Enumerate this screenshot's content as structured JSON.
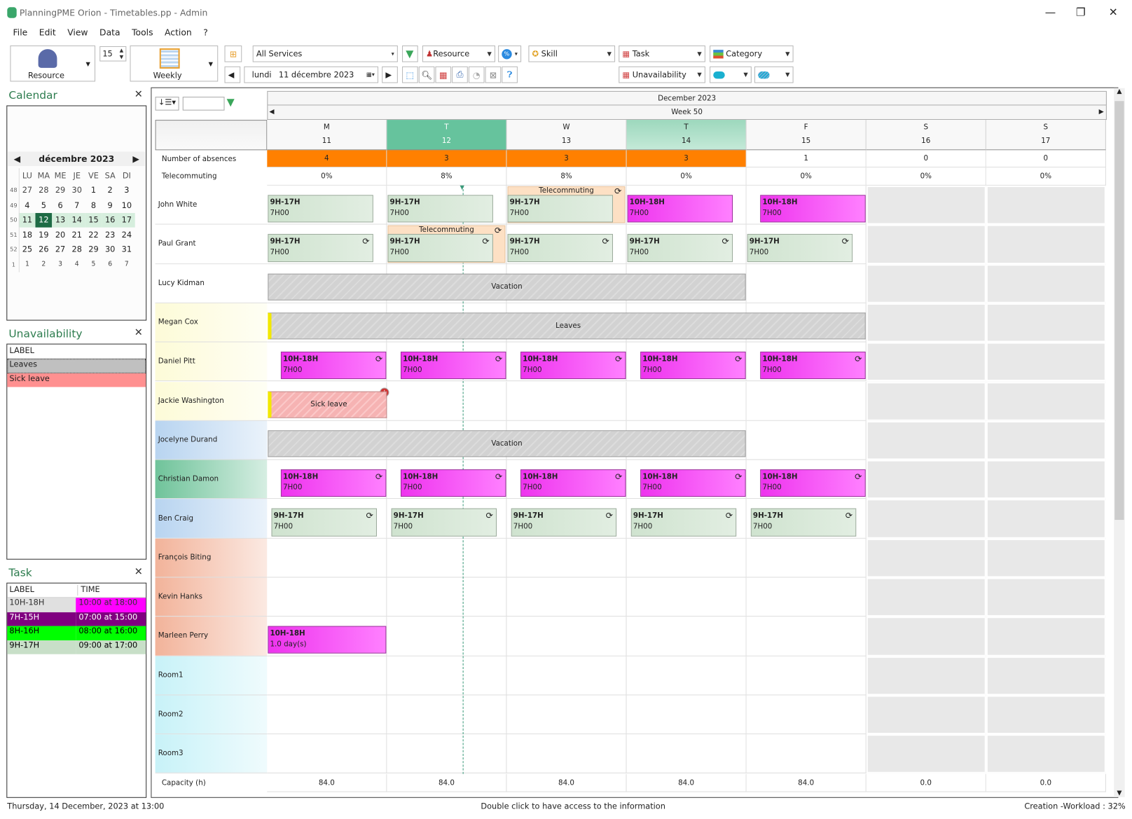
{
  "window": {
    "title": "PlanningPME Orion - Timetables.pp - Admin",
    "minimize": "—",
    "restore": "❐",
    "close": "✕"
  },
  "menu": [
    "File",
    "Edit",
    "View",
    "Data",
    "Tools",
    "Action",
    "?"
  ],
  "toolbar": {
    "view_mode": "Resource",
    "spinner_value": "15",
    "period": "Weekly",
    "services": "All Services",
    "resource_filter": "Resource",
    "skill": "Skill",
    "task": "Task",
    "category": "Category",
    "unavailability": "Unavailability",
    "date_day": "lundi",
    "date": "11 décembre 2023"
  },
  "calendar_panel": {
    "title": "Calendar",
    "month": "décembre 2023",
    "weekdays": [
      "LU",
      "MA",
      "ME",
      "JE",
      "VE",
      "SA",
      "DI"
    ],
    "weeks": [
      {
        "num": "48",
        "days": [
          "27",
          "28",
          "29",
          "30",
          "1",
          "2",
          "3"
        ]
      },
      {
        "num": "49",
        "days": [
          "4",
          "5",
          "6",
          "7",
          "8",
          "9",
          "10"
        ]
      },
      {
        "num": "50",
        "days": [
          "11",
          "12",
          "13",
          "14",
          "15",
          "16",
          "17"
        ],
        "current": true
      },
      {
        "num": "51",
        "days": [
          "18",
          "19",
          "20",
          "21",
          "22",
          "23",
          "24"
        ]
      },
      {
        "num": "52",
        "days": [
          "25",
          "26",
          "27",
          "28",
          "29",
          "30",
          "31"
        ]
      },
      {
        "num": "1",
        "days": [
          "1",
          "2",
          "3",
          "4",
          "5",
          "6",
          "7"
        ]
      }
    ],
    "selected_day": "12"
  },
  "unavailability_panel": {
    "title": "Unavailability",
    "header": "LABEL",
    "items": [
      {
        "label": "Leaves",
        "color": "#c0c0c0"
      },
      {
        "label": "Sick leave",
        "color": "#ff9090"
      }
    ]
  },
  "task_panel": {
    "title": "Task",
    "headers": [
      "LABEL",
      "TIME"
    ],
    "items": [
      {
        "label": "10H-18H",
        "time": "10:00 at 18:00",
        "color": "#ff00ff",
        "label_bg": "#e0e0e0",
        "text": "#333"
      },
      {
        "label": "7H-15H",
        "time": "07:00 at 15:00",
        "color": "#800080",
        "label_bg": "#800080",
        "text": "#fff"
      },
      {
        "label": "8H-16H",
        "time": "08:00 at 16:00",
        "color": "#00ff00",
        "label_bg": "#00ff00",
        "text": "#000"
      },
      {
        "label": "9H-17H",
        "time": "09:00 at 17:00",
        "color": "#c8dfc8",
        "label_bg": "#c8dfc8",
        "text": "#000"
      }
    ]
  },
  "planning": {
    "month": "December 2023",
    "week": "Week 50",
    "days": [
      {
        "letter": "M",
        "num": "11"
      },
      {
        "letter": "T",
        "num": "12",
        "today": true
      },
      {
        "letter": "W",
        "num": "13"
      },
      {
        "letter": "T",
        "num": "14",
        "highlight": true
      },
      {
        "letter": "F",
        "num": "15"
      },
      {
        "letter": "S",
        "num": "16",
        "weekend": true
      },
      {
        "letter": "S",
        "num": "17",
        "weekend": true
      }
    ],
    "absences": {
      "label": "Number of absences",
      "values": [
        "4",
        "3",
        "3",
        "3",
        "1",
        "0",
        "0"
      ]
    },
    "telecommuting": {
      "label": "Telecommuting",
      "values": [
        "0%",
        "8%",
        "8%",
        "0%",
        "0%",
        "0%",
        "0%"
      ]
    },
    "capacity": {
      "label": "Capacity (h)",
      "values": [
        "84.0",
        "84.0",
        "84.0",
        "84.0",
        "84.0",
        "0.0",
        "0.0"
      ]
    },
    "resources": [
      {
        "name": "John White",
        "color": "#ffffff"
      },
      {
        "name": "Paul Grant",
        "color": "#ffffff"
      },
      {
        "name": "Lucy Kidman",
        "color": "#ffffff"
      },
      {
        "name": "Megan Cox",
        "color": "#fdfbd8"
      },
      {
        "name": "Daniel Pitt",
        "color": "#fdfbd8"
      },
      {
        "name": "Jackie Washington",
        "color": "#fdfbd8"
      },
      {
        "name": "Jocelyne Durand",
        "color": "#b8d4f0"
      },
      {
        "name": "Christian Damon",
        "color": "#6fc39a"
      },
      {
        "name": "Ben Craig",
        "color": "#b8d4f0"
      },
      {
        "name": "François Biting",
        "color": "#f2b39a"
      },
      {
        "name": "Kevin Hanks",
        "color": "#f2b39a"
      },
      {
        "name": "Marleen Perry",
        "color": "#f2b39a"
      },
      {
        "name": "Room1",
        "color": "#c8f2f8"
      },
      {
        "name": "Room2",
        "color": "#c8f2f8"
      },
      {
        "name": "Room3",
        "color": "#c8f2f8"
      }
    ],
    "telecommuting_label": "Telecommuting",
    "events": [
      {
        "row": 0,
        "day": 0,
        "kind": "green",
        "label": "9H-17H",
        "sub": "7H00"
      },
      {
        "row": 0,
        "day": 1,
        "kind": "green",
        "label": "9H-17H",
        "sub": "7H00"
      },
      {
        "row": 0,
        "day": 2,
        "kind": "green",
        "label": "9H-17H",
        "sub": "7H00",
        "telecommuting": true
      },
      {
        "row": 0,
        "day": 3,
        "kind": "magenta",
        "label": "10H-18H",
        "sub": "7H00"
      },
      {
        "row": 0,
        "day": 4,
        "kind": "magenta",
        "label": "10H-18H",
        "sub": "7H00",
        "late_start": true
      },
      {
        "row": 1,
        "day": 0,
        "kind": "green",
        "label": "9H-17H",
        "sub": "7H00",
        "sync": true
      },
      {
        "row": 1,
        "day": 1,
        "kind": "green",
        "label": "9H-17H",
        "sub": "7H00",
        "sync": true,
        "telecommuting": true
      },
      {
        "row": 1,
        "day": 2,
        "kind": "green",
        "label": "9H-17H",
        "sub": "7H00",
        "sync": true
      },
      {
        "row": 1,
        "day": 3,
        "kind": "green",
        "label": "9H-17H",
        "sub": "7H00",
        "sync": true
      },
      {
        "row": 1,
        "day": 4,
        "kind": "green",
        "label": "9H-17H",
        "sub": "7H00",
        "sync": true
      },
      {
        "row": 2,
        "day": 0,
        "days": 4,
        "kind": "vac",
        "label": "Vacation"
      },
      {
        "row": 3,
        "day": 0,
        "days": 5,
        "kind": "vac leaves",
        "label": "Leaves"
      },
      {
        "row": 4,
        "day": 0,
        "kind": "magenta",
        "label": "10H-18H",
        "sub": "7H00",
        "sync": true,
        "late_start": true
      },
      {
        "row": 4,
        "day": 1,
        "kind": "magenta",
        "label": "10H-18H",
        "sub": "7H00",
        "sync": true,
        "late_start": true
      },
      {
        "row": 4,
        "day": 2,
        "kind": "magenta",
        "label": "10H-18H",
        "sub": "7H00",
        "sync": true,
        "late_start": true
      },
      {
        "row": 4,
        "day": 3,
        "kind": "magenta",
        "label": "10H-18H",
        "sub": "7H00",
        "sync": true,
        "late_start": true
      },
      {
        "row": 4,
        "day": 4,
        "kind": "magenta",
        "label": "10H-18H",
        "sub": "7H00",
        "sync": true,
        "late_start": true
      },
      {
        "row": 5,
        "day": 0,
        "days": 1,
        "kind": "sick",
        "label": "Sick leave",
        "add": true
      },
      {
        "row": 6,
        "day": 0,
        "days": 4,
        "kind": "vac",
        "label": "Vacation"
      },
      {
        "row": 7,
        "day": 0,
        "kind": "magenta",
        "label": "10H-18H",
        "sub": "7H00",
        "sync": true,
        "late_start": true
      },
      {
        "row": 7,
        "day": 1,
        "kind": "magenta",
        "label": "10H-18H",
        "sub": "7H00",
        "sync": true,
        "late_start": true
      },
      {
        "row": 7,
        "day": 2,
        "kind": "magenta",
        "label": "10H-18H",
        "sub": "7H00",
        "sync": true,
        "late_start": true
      },
      {
        "row": 7,
        "day": 3,
        "kind": "magenta",
        "label": "10H-18H",
        "sub": "7H00",
        "sync": true,
        "late_start": true
      },
      {
        "row": 7,
        "day": 4,
        "kind": "magenta",
        "label": "10H-18H",
        "sub": "7H00",
        "sync": true,
        "late_start": true
      },
      {
        "row": 8,
        "day": 0,
        "kind": "green",
        "label": "9H-17H",
        "sub": "7H00",
        "sync": true
      },
      {
        "row": 8,
        "day": 1,
        "kind": "green",
        "label": "9H-17H",
        "sub": "7H00",
        "sync": true
      },
      {
        "row": 8,
        "day": 2,
        "kind": "green",
        "label": "9H-17H",
        "sub": "7H00",
        "sync": true
      },
      {
        "row": 8,
        "day": 3,
        "kind": "green",
        "label": "9H-17H",
        "sub": "7H00",
        "sync": true
      },
      {
        "row": 8,
        "day": 4,
        "kind": "green",
        "label": "9H-17H",
        "sub": "7H00",
        "sync": true
      },
      {
        "row": 11,
        "day": 0,
        "days": 1,
        "kind": "magenta",
        "label": "10H-18H",
        "sub": "1.0 day(s)"
      }
    ]
  },
  "status": {
    "left": "Thursday, 14 December, 2023 at 13:00",
    "center": "Double click to have access to the information",
    "right": "Creation -Workload : 32%"
  },
  "colors": {
    "accent": "#2e7d4f",
    "today": "#66c39d",
    "absences": "#ff8000",
    "weekend": "#e8e8e8"
  }
}
